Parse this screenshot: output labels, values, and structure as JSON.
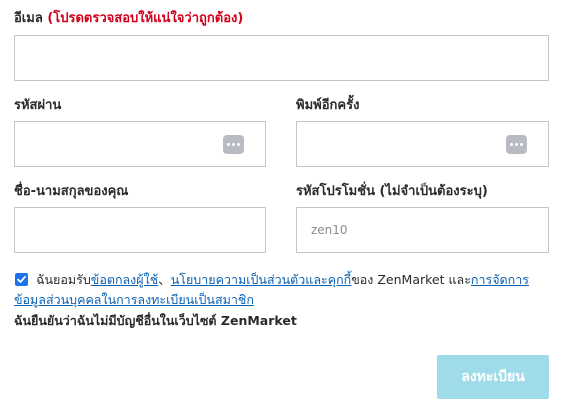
{
  "form": {
    "email": {
      "label": "อีเมล",
      "hint": "(โปรดตรวจสอบให้แน่ใจว่าถูกต้อง)",
      "value": ""
    },
    "password": {
      "label": "รหัสผ่าน",
      "value": "",
      "icon": "password-dots-icon"
    },
    "password_confirm": {
      "label": "พิมพ์อีกครั้ง",
      "value": "",
      "icon": "password-dots-icon"
    },
    "name": {
      "label": "ชื่อ-นามสกุลของคุณ",
      "value": ""
    },
    "promo": {
      "label": "รหัสโปรโมชั่น (ไม่จำเป็นต้องระบุ)",
      "placeholder": "zen10",
      "value": ""
    },
    "terms": {
      "checked": true,
      "prefix": "ฉันยอมรับ",
      "link_user_agreement": "ข้อตกลงผู้ใช้",
      "separator": "、",
      "link_privacy": "นโยบายความเป็นส่วนตัวและคุกกี้",
      "middle": "ของ ZenMarket และ",
      "link_data": "การจัดการข้อมูลส่วนบุคคลในการลงทะเบียนเป็นสมาชิก"
    },
    "confirm_text": "ฉันยืนยันว่าฉันไม่มีบัญชีอื่นในเว็บไซต์ ZenMarket",
    "submit_label": "ลงทะเบียน"
  },
  "colors": {
    "hint": "#d0021b",
    "link": "#0b61b2",
    "checkbox": "#1a73e8",
    "submit_bg": "#9fdbe9",
    "border": "#c4c4c4"
  }
}
